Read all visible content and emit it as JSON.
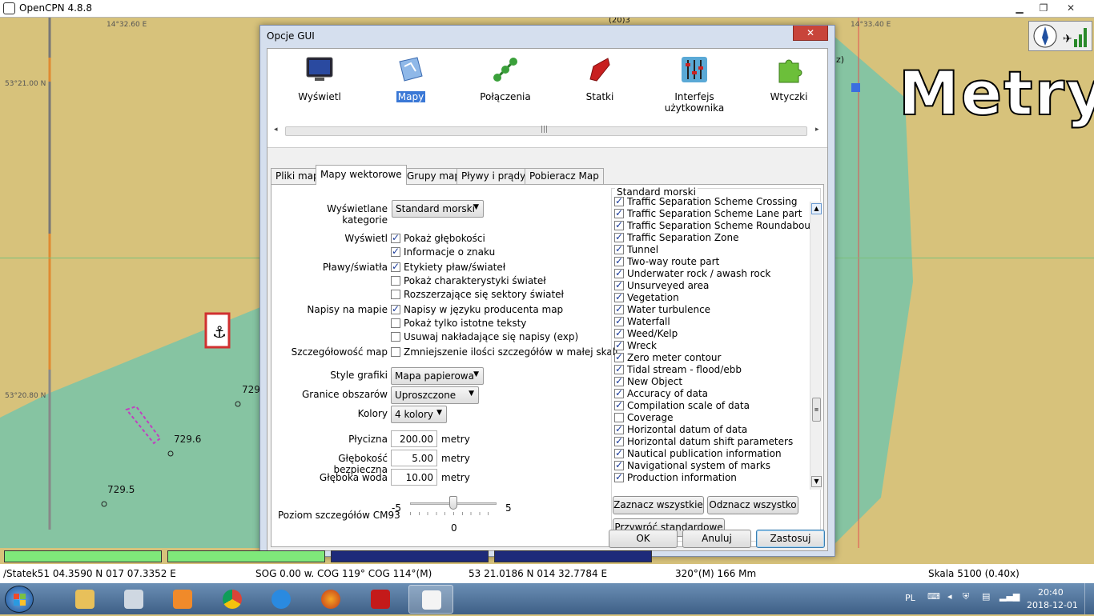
{
  "app": {
    "title": "OpenCPN 4.8.8"
  },
  "chart": {
    "coords": [
      "14°32.60 E",
      "14°33.40 E",
      "53°21.00 N",
      "53°20.80 N"
    ],
    "depths": [
      "729",
      "729.6",
      "729.5"
    ],
    "units_label": "Metry",
    "fragment_a": "(20)3",
    "fragment_b": "z)"
  },
  "dialog": {
    "title": "Opcje GUI",
    "close": "✕",
    "toolbar": [
      {
        "label": "Wyświetl",
        "icon": "display-icon"
      },
      {
        "label": "Mapy",
        "icon": "charts-icon"
      },
      {
        "label": "Połączenia",
        "icon": "connections-icon"
      },
      {
        "label": "Statki",
        "icon": "ships-icon"
      },
      {
        "label": "Interfejs użytkownika",
        "icon": "ui-sliders-icon"
      },
      {
        "label": "Wtyczki",
        "icon": "plugins-icon"
      }
    ],
    "scroll": {
      "left": "◂",
      "grip": "|||",
      "right": "▸"
    },
    "tabs": [
      "Pliki map",
      "Mapy wektorowe",
      "Grupy map",
      "Pływy i prądy",
      "Pobieracz Map"
    ],
    "form": {
      "categories_label": "Wyświetlane kategorie",
      "categories_value": "Standard morski",
      "display_label": "Wyświetl",
      "show_depths": "Pokaż głębokości",
      "sign_info": "Informacje o znaku",
      "buoys_label": "Pławy/światła",
      "buoy_labels": "Etykiety pław/świateł",
      "light_chars": "Pokaż charakterystyki świateł",
      "light_sectors": "Rozszerzające się sektory świateł",
      "text_label": "Napisy na mapie",
      "national_text": "Napisy w języku producenta map",
      "important_text": "Pokaż tylko istotne teksty",
      "declutter": "Usuwaj nakładające się napisy (exp)",
      "detail_label": "Szczegółowość map",
      "reduce_detail": "Zmniejszenie ilości szczegółów w małej skali",
      "graphics_label": "Style grafiki",
      "graphics_value": "Mapa papierowa",
      "boundaries_label": "Granice obszarów",
      "boundaries_value": "Uproszczone",
      "colors_label": "Kolory",
      "colors_value": "4 kolory",
      "shallow_label": "Płycizna",
      "shallow_value": "200.00",
      "safety_label": "Głębokość bezpieczna",
      "safety_value": "5.00",
      "deep_label": "Głęboka woda",
      "deep_value": "10.00",
      "unit": "metry",
      "cm93_label": "Poziom szczegółów CM93",
      "cm93_min": "-5",
      "cm93_max": "5",
      "cm93_value": "0",
      "cm93_level": 0
    },
    "list_caption": "Standard morski",
    "list_items": [
      {
        "label": "Traffic Separation Scheme Crossing",
        "checked": true
      },
      {
        "label": "Traffic Separation Scheme  Lane part",
        "checked": true
      },
      {
        "label": "Traffic Separation Scheme  Roundabout",
        "checked": true
      },
      {
        "label": "Traffic Separation Zone",
        "checked": true
      },
      {
        "label": "Tunnel",
        "checked": true
      },
      {
        "label": "Two-way route  part",
        "checked": true
      },
      {
        "label": "Underwater rock / awash rock",
        "checked": true
      },
      {
        "label": "Unsurveyed area",
        "checked": true
      },
      {
        "label": "Vegetation",
        "checked": true
      },
      {
        "label": "Water turbulence",
        "checked": true
      },
      {
        "label": "Waterfall",
        "checked": true
      },
      {
        "label": "Weed/Kelp",
        "checked": true
      },
      {
        "label": "Wreck",
        "checked": true
      },
      {
        "label": "Zero meter contour",
        "checked": true
      },
      {
        "label": "Tidal stream - flood/ebb",
        "checked": true
      },
      {
        "label": "New Object",
        "checked": true
      },
      {
        "label": "Accuracy of data",
        "checked": true
      },
      {
        "label": "Compilation scale of data",
        "checked": true
      },
      {
        "label": "Coverage",
        "checked": false
      },
      {
        "label": "Horizontal datum of data",
        "checked": true
      },
      {
        "label": "Horizontal datum shift parameters",
        "checked": true
      },
      {
        "label": "Nautical publication information",
        "checked": true
      },
      {
        "label": "Navigational system of marks",
        "checked": true
      },
      {
        "label": "Production information",
        "checked": true
      }
    ],
    "buttons": {
      "select_all": "Zaznacz wszystkie",
      "deselect_all": "Odznacz wszystko",
      "restore": "Przywróć standardowe",
      "ok": "OK",
      "cancel": "Anuluj",
      "apply": "Zastosuj"
    }
  },
  "status": {
    "ship": "/Statek51 04.3590 N   017 07.3352 E",
    "sog": "SOG 0.00 w.  COG 119°  COG 114°(M)",
    "cursor": "53 21.0186 N   014 32.7784 E",
    "bearing": "320°(M)  166 Mm",
    "scale": "Skala 5100 (0.40x)"
  },
  "taskbar": {
    "lang": "PL",
    "time": "20:40",
    "date": "2018-12-01"
  }
}
